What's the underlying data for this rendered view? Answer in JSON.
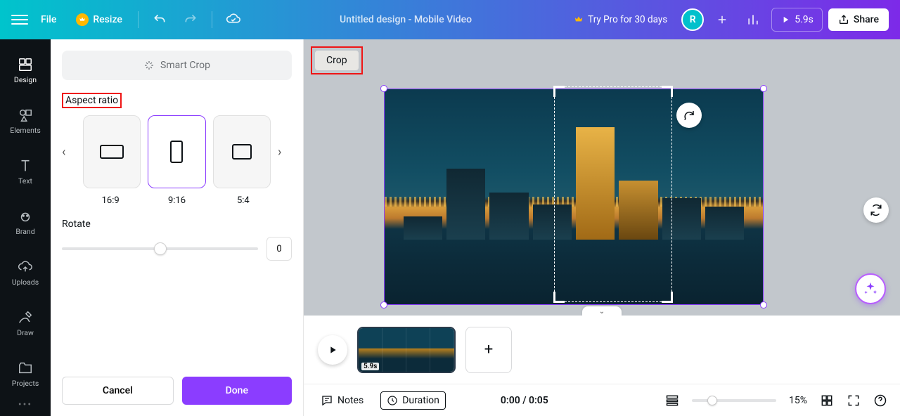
{
  "header": {
    "file": "File",
    "resize": "Resize",
    "title": "Untitled design - Mobile Video",
    "try_pro": "Try Pro for 30 days",
    "avatar_letter": "R",
    "play_duration": "5.9s",
    "share": "Share"
  },
  "rail": {
    "design": "Design",
    "elements": "Elements",
    "text": "Text",
    "brand": "Brand",
    "uploads": "Uploads",
    "draw": "Draw",
    "projects": "Projects"
  },
  "panel": {
    "smart_crop": "Smart Crop",
    "aspect_ratio_label": "Aspect ratio",
    "ratios": {
      "a": "16:9",
      "b": "9:16",
      "c": "5:4"
    },
    "rotate_label": "Rotate",
    "rotate_value": "0",
    "cancel": "Cancel",
    "done": "Done"
  },
  "canvas": {
    "crop_tag": "Crop"
  },
  "timeline": {
    "clip_duration": "5.9s"
  },
  "bottombar": {
    "notes": "Notes",
    "duration": "Duration",
    "time": "0:00 / 0:05",
    "zoom": "15%"
  }
}
